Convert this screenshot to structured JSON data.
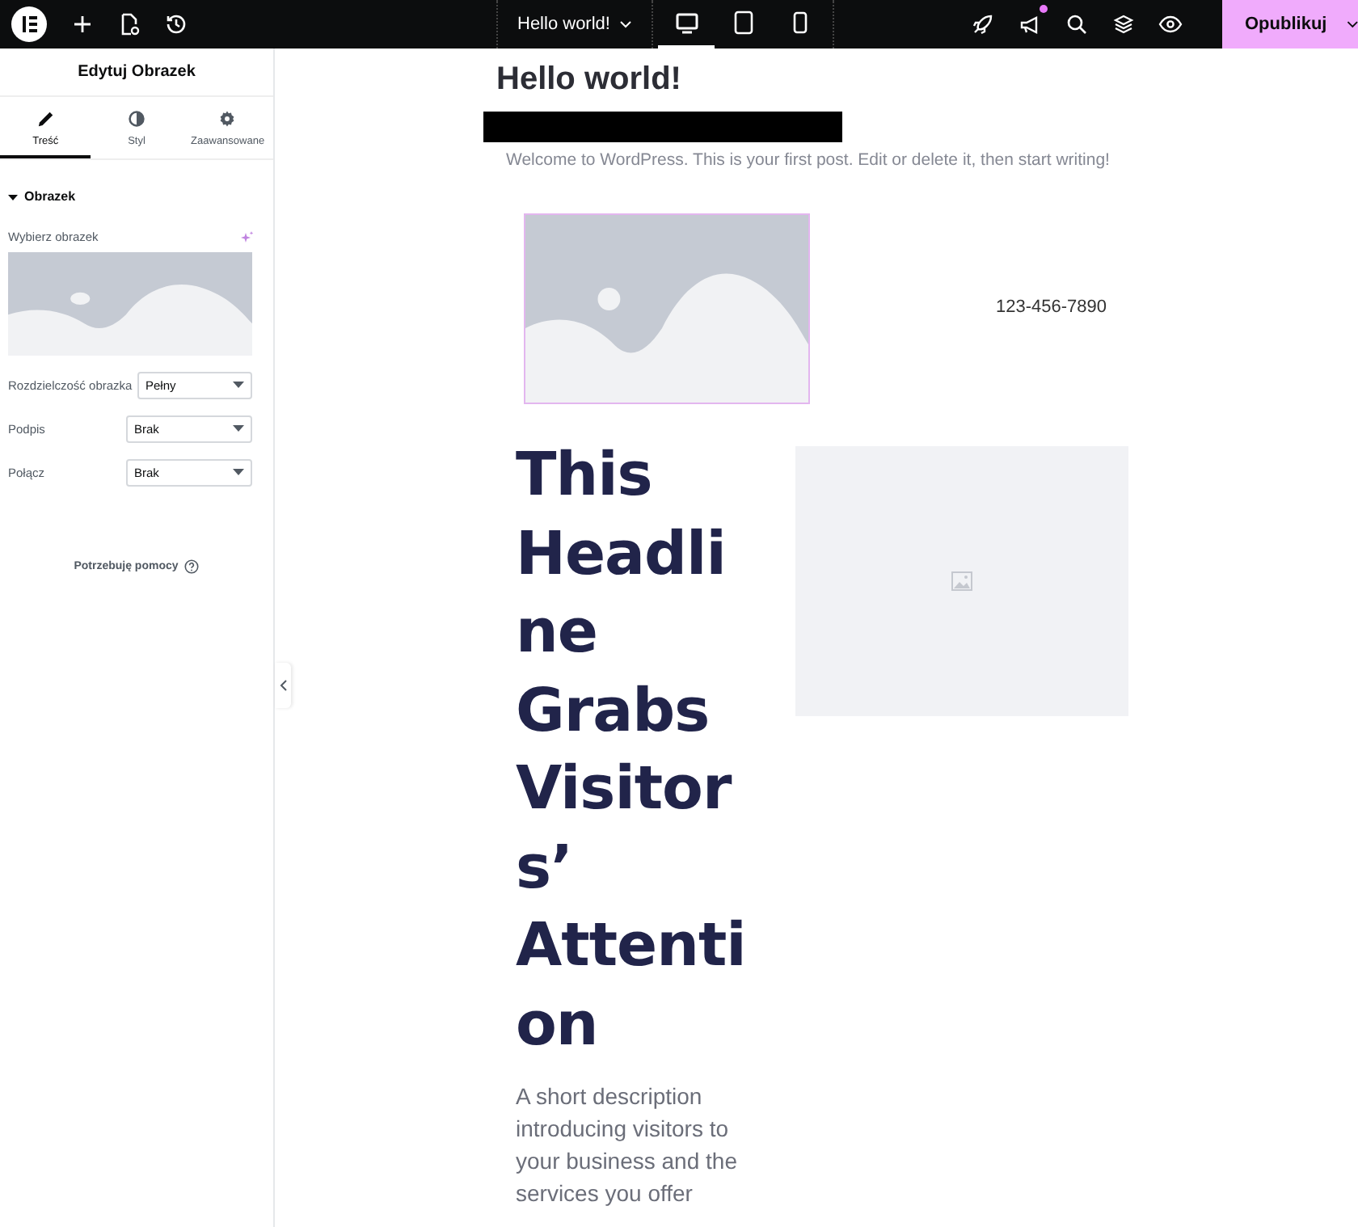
{
  "topbar": {
    "page_title": "Hello world!",
    "devices": [
      {
        "kind": "desktop",
        "selected": true
      },
      {
        "kind": "tablet",
        "selected": false
      },
      {
        "kind": "mobile",
        "selected": false
      }
    ],
    "notification_dot": true,
    "publish_label": "Opublikuj"
  },
  "panel": {
    "title": "Edytuj Obrazek",
    "tabs": [
      {
        "label": "Treść",
        "kind": "pencil",
        "selected": true
      },
      {
        "label": "Styl",
        "kind": "contrast",
        "selected": false
      },
      {
        "label": "Zaawansowane",
        "kind": "gear",
        "selected": false
      }
    ],
    "section": {
      "title": "Obrazek",
      "expanded": true
    },
    "image_label": "Wybierz obrazek",
    "fields": [
      {
        "label": "Rozdzielczość obrazka",
        "value": "Pełny"
      },
      {
        "label": "Podpis",
        "value": "Brak"
      },
      {
        "label": "Połącz",
        "value": "Brak"
      }
    ],
    "help": "Potrzebuję pomocy"
  },
  "canvas": {
    "post_title": "Hello world!",
    "post_text": "Welcome to WordPress. This is your first post. Edit or delete it, then start writing!",
    "phone": "123-456-7890",
    "headline_lines": [
      "This",
      "Headli",
      "ne",
      "Grabs",
      "Visitor",
      "s’",
      "Attenti",
      "on"
    ],
    "description": "A short description introducing visitors to your business and the services you offer"
  }
}
